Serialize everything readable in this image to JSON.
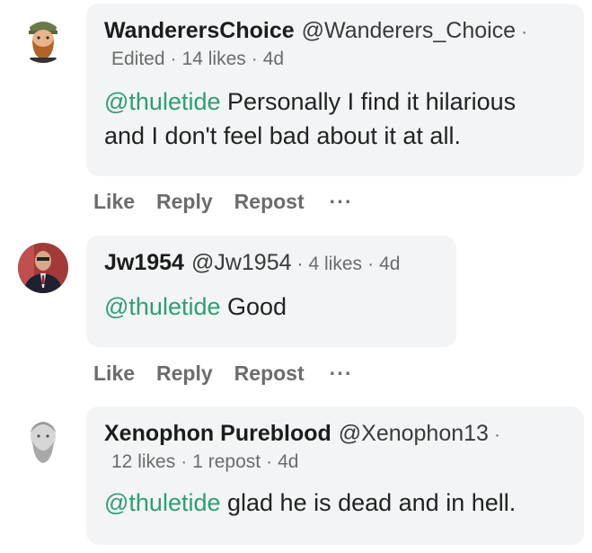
{
  "comments": [
    {
      "name": "WanderersChoice",
      "handle": "@Wanderers_Choice",
      "trail_dot": "·",
      "edited": "Edited",
      "likes": "14 likes",
      "time": "4d",
      "mention": "@thuletide",
      "text_line1": " Personally I find it hilarious",
      "text_line2": "and I don't feel bad about it at all.",
      "avatar": "bearded-man-icon"
    },
    {
      "name": "Jw1954",
      "handle": "@Jw1954",
      "dot": "·",
      "likes": "4 likes",
      "time": "4d",
      "mention": "@thuletide",
      "text": " Good",
      "avatar": "man-in-suit-photo"
    },
    {
      "name": "Xenophon Pureblood",
      "handle": "@Xenophon13",
      "trail_dot": "·",
      "likes": "12 likes",
      "reposts": "1 repost",
      "time": "4d",
      "mention": "@thuletide",
      "text": " glad he is dead and in hell.",
      "avatar": "marble-bust-photo"
    }
  ],
  "actions": {
    "like": "Like",
    "reply": "Reply",
    "repost": "Repost",
    "more": "···"
  },
  "colors": {
    "mention": "#2e9e72",
    "bubble": "#f2f4f6",
    "meta": "#6b6b6b"
  }
}
